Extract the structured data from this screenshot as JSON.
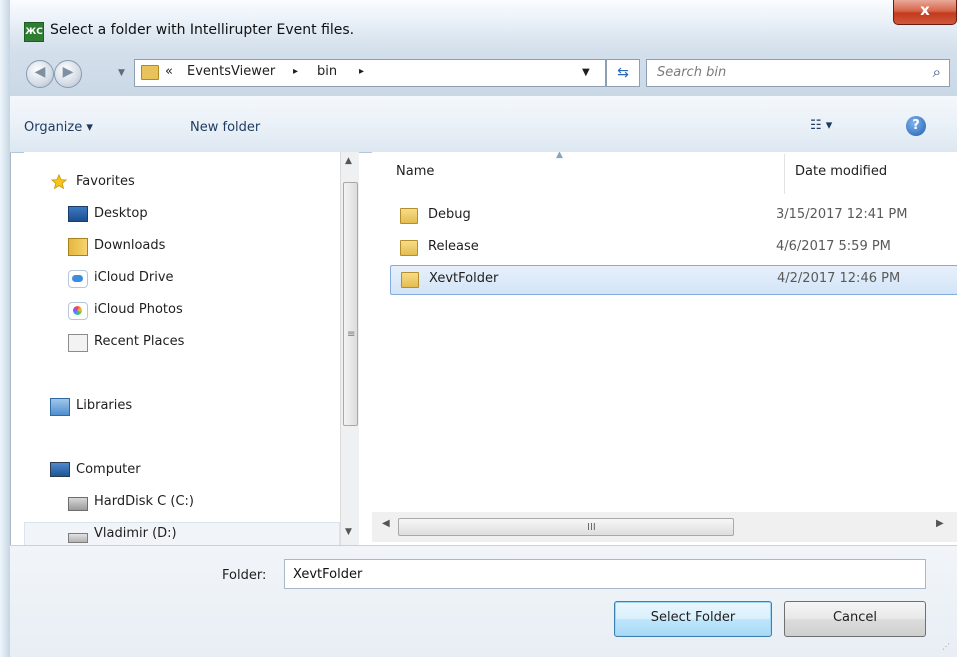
{
  "window": {
    "title": "Select a folder with Intellirupter Event files.",
    "icon_label": "ЖС",
    "close_label": "x"
  },
  "address": {
    "chevrons": "«",
    "segments": [
      "EventsViewer",
      "bin"
    ],
    "separator": "▸",
    "search_placeholder": "Search bin"
  },
  "toolbar": {
    "organize": "Organize ▾",
    "new_folder": "New folder",
    "views": "☷ ▾",
    "help": "?"
  },
  "navigation": {
    "favorites": "Favorites",
    "favorites_items": [
      "Desktop",
      "Downloads",
      "iCloud Drive",
      "iCloud Photos",
      "Recent Places"
    ],
    "libraries": "Libraries",
    "computer": "Computer",
    "computer_items": [
      "HardDisk C (C:)",
      "Vladimir (D:)"
    ]
  },
  "file_list": {
    "columns": {
      "name": "Name",
      "date": "Date modified"
    },
    "rows": [
      {
        "name": "Debug",
        "date": "3/15/2017 12:41 PM",
        "selected": false
      },
      {
        "name": "Release",
        "date": "4/6/2017 5:59 PM",
        "selected": false
      },
      {
        "name": "XevtFolder",
        "date": "4/2/2017 12:46 PM",
        "selected": true
      }
    ]
  },
  "bottom": {
    "folder_label": "Folder:",
    "folder_value": "XevtFolder",
    "select_button": "Select Folder",
    "cancel_button": "Cancel"
  },
  "icons": {
    "back": "back-arrow-icon",
    "forward": "forward-arrow-icon",
    "refresh": "refresh-icon",
    "search": "magnifier-icon",
    "folder": "folder-icon",
    "star": "star-icon"
  },
  "colors": {
    "selection": "#d3e4f7",
    "selection_border": "#84acdd",
    "link_text": "#1e3a5f",
    "close_red": "#c4391c"
  }
}
